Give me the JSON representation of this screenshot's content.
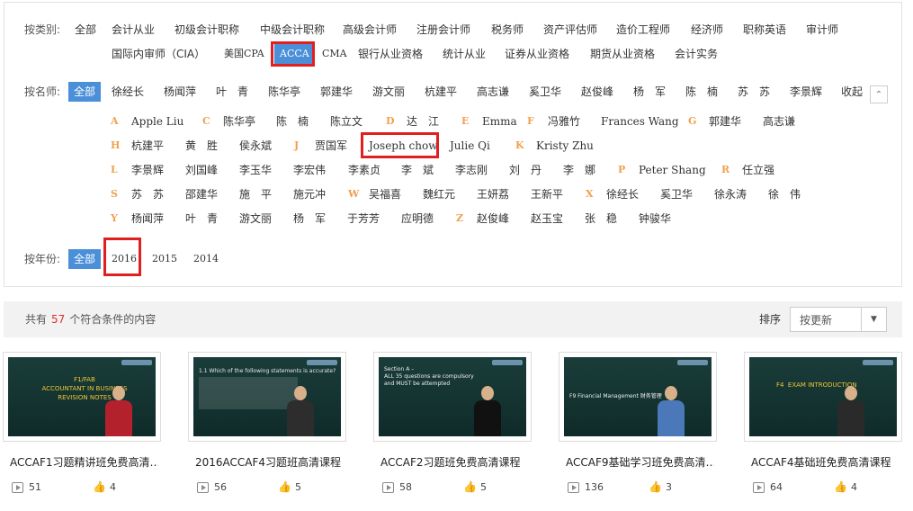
{
  "filters": {
    "category": {
      "label": "按类别:",
      "options_row1": [
        "全部",
        "会计从业",
        "初级会计职称",
        "中级会计职称",
        "高级会计师",
        "注册会计师",
        "税务师",
        "资产评估师",
        "造价工程师",
        "经济师",
        "职称英语",
        "审计师"
      ],
      "options_row2": [
        "国际内审师（CIA）",
        "美国CPA",
        "ACCA",
        "CMA",
        "银行从业资格",
        "统计从业",
        "证券从业资格",
        "期货从业资格",
        "会计实务"
      ],
      "selected": "ACCA"
    },
    "teacher": {
      "label": "按名师:",
      "top": [
        "全部",
        "徐经长",
        "杨闻萍",
        "叶　青",
        "陈华亭",
        "郭建华",
        "游文丽",
        "杭建平",
        "高志谦",
        "奚卫华",
        "赵俊峰",
        "杨　军",
        "陈　楠",
        "苏　苏",
        "李景辉",
        "收起"
      ],
      "selected": "全部",
      "groups": [
        {
          "letter": "A",
          "names": [
            "Apple Liu"
          ]
        },
        {
          "letter": "C",
          "names": [
            "陈华亭",
            "陈　楠",
            "陈立文"
          ]
        },
        {
          "letter": "D",
          "names": [
            "达　江"
          ]
        },
        {
          "letter": "E",
          "names": [
            "Emma"
          ]
        },
        {
          "letter": "F",
          "names": [
            "冯雅竹",
            "Frances Wang"
          ]
        },
        {
          "letter": "G",
          "names": [
            "郭建华",
            "高志谦"
          ]
        },
        {
          "letter": "H",
          "names": [
            "杭建平",
            "黄　胜",
            "侯永斌"
          ]
        },
        {
          "letter": "J",
          "names": [
            "贾国军",
            "Joseph chow",
            "Julie Qi"
          ]
        },
        {
          "letter": "K",
          "names": [
            "Kristy Zhu"
          ]
        },
        {
          "letter": "L",
          "names": [
            "李景辉",
            "刘国峰",
            "李玉华",
            "李宏伟",
            "李素贞",
            "李　斌",
            "李志刚",
            "刘　丹",
            "李　娜"
          ]
        },
        {
          "letter": "P",
          "names": [
            "Peter Shang"
          ]
        },
        {
          "letter": "R",
          "names": [
            "任立强"
          ]
        },
        {
          "letter": "S",
          "names": [
            "苏　苏",
            "邵建华",
            "施　平",
            "施元冲"
          ]
        },
        {
          "letter": "W",
          "names": [
            "吴福喜",
            "魏红元",
            "王妍荔",
            "王新平"
          ]
        },
        {
          "letter": "X",
          "names": [
            "徐经长",
            "奚卫华",
            "徐永涛",
            "徐　伟"
          ]
        },
        {
          "letter": "Y",
          "names": [
            "杨闻萍",
            "叶　青",
            "游文丽",
            "杨　军",
            "于芳芳",
            "应明德"
          ]
        },
        {
          "letter": "Z",
          "names": [
            "赵俊峰",
            "赵玉宝",
            "张　稳",
            "钟骏华"
          ]
        }
      ]
    },
    "year": {
      "label": "按年份:",
      "options": [
        "全部",
        "2016",
        "2015",
        "2014"
      ],
      "selected": "全部"
    }
  },
  "results": {
    "prefix": "共有",
    "count": "57",
    "suffix": "个符合条件的内容",
    "sort_label": "排序",
    "sort_value": "按更新"
  },
  "courses": [
    {
      "title": "ACCAF1习题精讲班免费高清…",
      "plays": "51",
      "likes": "4",
      "slide_title": "F1/FAB\nACCOUNTANT IN BUSINESS\nREVISION NOTES"
    },
    {
      "title": "2016ACCAF4习题班高清课程",
      "plays": "56",
      "likes": "5",
      "slide_title": "1.1 Which of the following statements is accurate?"
    },
    {
      "title": "ACCAF2习题班免费高清课程",
      "plays": "58",
      "likes": "5",
      "slide_title": "Section A –\nALL 35 questions are compulsory\nand MUST be attempted"
    },
    {
      "title": "ACCAF9基础学习班免费高清…",
      "plays": "136",
      "likes": "3",
      "slide_title": "F9 Financial Management 财务管理"
    },
    {
      "title": "ACCAF4基础班免费高清课程",
      "plays": "64",
      "likes": "4",
      "slide_title": "F4  EXAM INTRODUCTION"
    }
  ],
  "colors": {
    "selected_bg": "#4a8fd8",
    "highlight_border": "#e02020",
    "letter": "#f0a050",
    "count": "#e03030"
  }
}
